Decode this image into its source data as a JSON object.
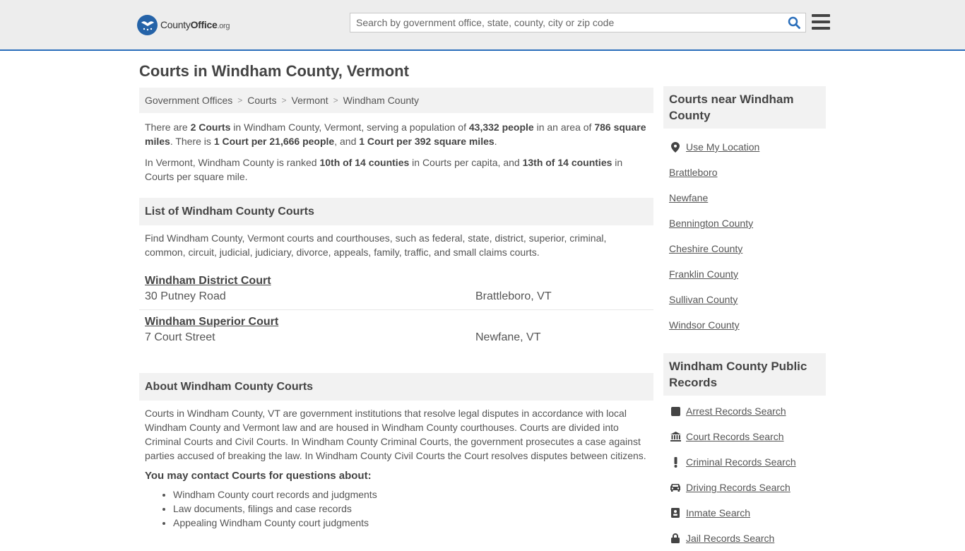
{
  "header": {
    "logo_name": "County",
    "logo_office": "Office",
    "logo_org": ".org",
    "search_placeholder": "Search by government office, state, county, city or zip code"
  },
  "page_title": "Courts in Windham County, Vermont",
  "breadcrumb": [
    "Government Offices",
    "Courts",
    "Vermont",
    "Windham County"
  ],
  "intro": {
    "p1": [
      "There are ",
      "2 Courts",
      " in Windham County, Vermont, serving a population of ",
      "43,332 people",
      " in an area of ",
      "786 square miles",
      ". There is ",
      "1 Court per 21,666 people",
      ", and ",
      "1 Court per 392 square miles",
      "."
    ],
    "p2": [
      "In Vermont, Windham County is ranked ",
      "10th of 14 counties",
      " in Courts per capita, and ",
      "13th of 14 counties",
      " in Courts per square mile."
    ]
  },
  "list_section": {
    "heading": "List of Windham County Courts",
    "description": "Find Windham County, Vermont courts and courthouses, such as federal, state, district, superior, criminal, common, circuit, judicial, judiciary, divorce, appeals, family, traffic, and small claims courts.",
    "courts": [
      {
        "name": "Windham District Court",
        "address": "30 Putney Road",
        "city": "Brattleboro, VT"
      },
      {
        "name": "Windham Superior Court",
        "address": "7 Court Street",
        "city": "Newfane, VT"
      }
    ]
  },
  "about_section": {
    "heading": "About Windham County Courts",
    "text": "Courts in Windham County, VT are government institutions that resolve legal disputes in accordance with local Windham County and Vermont law and are housed in Windham County courthouses. Courts are divided into Criminal Courts and Civil Courts. In Windham County Criminal Courts, the government prosecutes a case against parties accused of breaking the law. In Windham County Civil Courts the Court resolves disputes between citizens.",
    "contact_heading": "You may contact Courts for questions about:",
    "contact_items": [
      "Windham County court records and judgments",
      "Law documents, filings and case records",
      "Appealing Windham County court judgments"
    ]
  },
  "sidebar_nearby": {
    "heading": "Courts near Windham County",
    "use_location": "Use My Location",
    "links": [
      "Brattleboro",
      "Newfane",
      "Bennington County",
      "Cheshire County",
      "Franklin County",
      "Sullivan County",
      "Windsor County"
    ]
  },
  "sidebar_records": {
    "heading": "Windham County Public Records",
    "links": [
      {
        "label": "Arrest Records Search",
        "icon": "square-icon"
      },
      {
        "label": "Court Records Search",
        "icon": "courthouse-icon"
      },
      {
        "label": "Criminal Records Search",
        "icon": "exclamation-icon"
      },
      {
        "label": "Driving Records Search",
        "icon": "car-icon"
      },
      {
        "label": "Inmate Search",
        "icon": "id-card-icon"
      },
      {
        "label": "Jail Records Search",
        "icon": "lock-icon"
      }
    ]
  },
  "colors": {
    "accent": "#2a6ebb",
    "header_bg": "#ededed",
    "panel_bg": "#f2f2f2",
    "text": "#555555"
  }
}
